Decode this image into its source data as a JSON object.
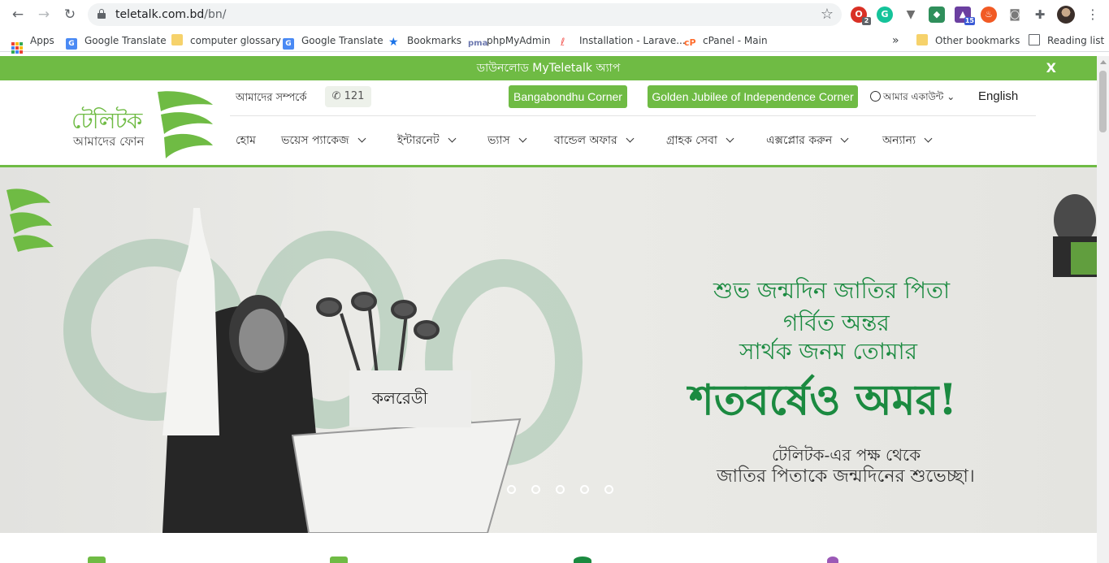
{
  "browser": {
    "url_host": "teletalk.com.bd",
    "url_path": "/bn/",
    "ext_badges": {
      "opera": "2",
      "graduation": "15"
    }
  },
  "bookmarks": {
    "apps": "Apps",
    "items": [
      "Google Translate",
      "computer glossary",
      "Google Translate",
      "Bookmarks",
      "phpMyAdmin",
      "Installation - Larave...",
      "cPanel - Main"
    ],
    "more": "»",
    "other": "Other bookmarks",
    "reading": "Reading list"
  },
  "promo": {
    "text": "ডাউনলোড MyTeletalk অ্যাপ",
    "close": "X"
  },
  "logo": {
    "line1": "টেলিটক",
    "line2": "আমাদের ফোন"
  },
  "topbar": {
    "about": "আমাদের সম্পর্কে",
    "phone": "121",
    "bangabandhu": "Bangabondhu Corner",
    "golden": "Golden Jubilee of Independence Corner",
    "account": "আমার একাউন্ট",
    "language": "English"
  },
  "nav": {
    "home": "হোম",
    "voice": "ভয়েস প্যাকেজ",
    "internet": "ইন্টারনেট",
    "vas": "ভ্যাস",
    "bundle": "বান্ডেল অফার",
    "care": "গ্রাহক সেবা",
    "explore": "এক্সপ্লোর করুন",
    "other": "অন্যান্য"
  },
  "hero": {
    "line1": "শুভ জন্মদিন জাতির পিতা",
    "line2": "গর্বিত অন্তর",
    "line3": "সার্থক জনম তোমার",
    "line4": "শতবর্ষেও অমর!",
    "sub1": "টেলিটক-এর পক্ষ থেকে",
    "sub2": "জাতির পিতাকে জন্মদিনের শুভেচ্ছা।",
    "podium": "কলরেডী"
  },
  "colors": {
    "brand_green": "#6fbb44",
    "hero_text": "#1b8a40"
  }
}
